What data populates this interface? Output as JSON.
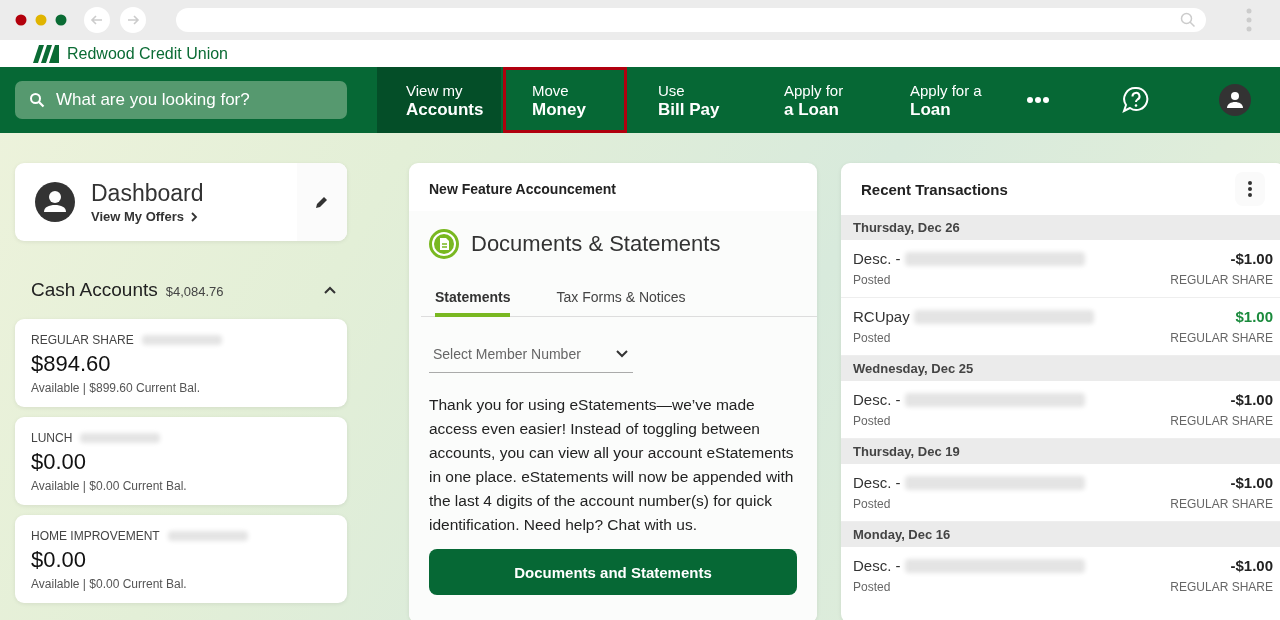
{
  "brand": {
    "name": "Redwood Credit Union"
  },
  "search": {
    "placeholder": "What are you looking for?"
  },
  "nav": [
    {
      "line1": "View my",
      "line2": "Accounts",
      "selected": true,
      "highlighted": false
    },
    {
      "line1": "Move",
      "line2": "Money",
      "selected": false,
      "highlighted": true
    },
    {
      "line1": "Use",
      "line2": "Bill Pay",
      "selected": false,
      "highlighted": false
    },
    {
      "line1": "Apply for",
      "line2": "a Loan",
      "selected": false,
      "highlighted": false
    },
    {
      "line1": "Apply for a",
      "line2": "Loan",
      "selected": false,
      "highlighted": false
    }
  ],
  "dashboard": {
    "title": "Dashboard",
    "link": "View My Offers"
  },
  "cash_accounts": {
    "title": "Cash Accounts",
    "total": "$4,084.76",
    "expanded": true,
    "accounts": [
      {
        "name": "REGULAR SHARE",
        "balance": "$894.60",
        "available": "Available",
        "separator": "|",
        "current": "$899.60 Current Bal."
      },
      {
        "name": "LUNCH",
        "balance": "$0.00",
        "available": "Available",
        "separator": "|",
        "current": "$0.00 Current Bal."
      },
      {
        "name": "HOME IMPROVEMENT",
        "balance": "$0.00",
        "available": "Available",
        "separator": "|",
        "current": "$0.00 Current Bal."
      }
    ]
  },
  "announcement": {
    "title": "New Feature Accouncement",
    "heading": "Documents & Statements",
    "tabs": [
      {
        "label": "Statements",
        "selected": true
      },
      {
        "label": "Tax Forms & Notices",
        "selected": false
      }
    ],
    "select": {
      "placeholder": "Select Member Number"
    },
    "body": "Thank you for using eStatements—we’ve made access even easier! Instead of toggling between accounts, you can view all your account eStatements in one place. eStatements will now be appended with the last 4 digits of the account number(s) for quick identification. Need help? Chat with us.",
    "button": "Documents and Statements"
  },
  "transactions": {
    "title": "Recent Transactions",
    "groups": [
      {
        "date": "Thursday, Dec 26",
        "items": [
          {
            "desc": "Desc. -",
            "amount": "-$1.00",
            "kind": "debit",
            "status": "Posted",
            "account": "REGULAR SHARE"
          },
          {
            "desc": "RCUpay",
            "amount": "$1.00",
            "kind": "credit",
            "status": "Posted",
            "account": "REGULAR SHARE"
          }
        ]
      },
      {
        "date": "Wednesday, Dec 25",
        "items": [
          {
            "desc": "Desc. -",
            "amount": "-$1.00",
            "kind": "debit",
            "status": "Posted",
            "account": "REGULAR SHARE"
          }
        ]
      },
      {
        "date": "Thursday, Dec 19",
        "items": [
          {
            "desc": "Desc. -",
            "amount": "-$1.00",
            "kind": "debit",
            "status": "Posted",
            "account": "REGULAR SHARE"
          }
        ]
      },
      {
        "date": "Monday, Dec 16",
        "items": [
          {
            "desc": "Desc. -",
            "amount": "-$1.00",
            "kind": "debit",
            "status": "Posted",
            "account": "REGULAR SHARE"
          }
        ]
      }
    ]
  }
}
